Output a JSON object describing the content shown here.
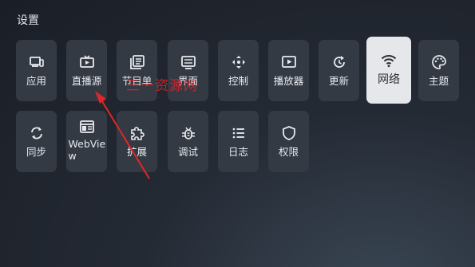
{
  "page_title": "设置",
  "tiles": [
    {
      "label": "应用",
      "icon": "device-icon"
    },
    {
      "label": "直播源",
      "icon": "tv-icon"
    },
    {
      "label": "节目单",
      "icon": "list-book-icon"
    },
    {
      "label": "界面",
      "icon": "screen-icon"
    },
    {
      "label": "控制",
      "icon": "dpad-icon"
    },
    {
      "label": "播放器",
      "icon": "play-icon"
    },
    {
      "label": "更新",
      "icon": "update-icon"
    },
    {
      "label": "网络",
      "icon": "wifi-icon"
    },
    {
      "label": "主题",
      "icon": "palette-icon"
    },
    {
      "label": "同步",
      "icon": "sync-icon"
    },
    {
      "label": "WebView",
      "icon": "webview-icon"
    },
    {
      "label": "扩展",
      "icon": "puzzle-icon"
    },
    {
      "label": "调试",
      "icon": "bug-icon"
    },
    {
      "label": "日志",
      "icon": "log-icon"
    },
    {
      "label": "权限",
      "icon": "shield-icon"
    }
  ],
  "watermark": "三一资源网",
  "colors": {
    "tile": "#343a44",
    "active_tile": "#e6e7ea",
    "annotation": "#e0262a"
  }
}
